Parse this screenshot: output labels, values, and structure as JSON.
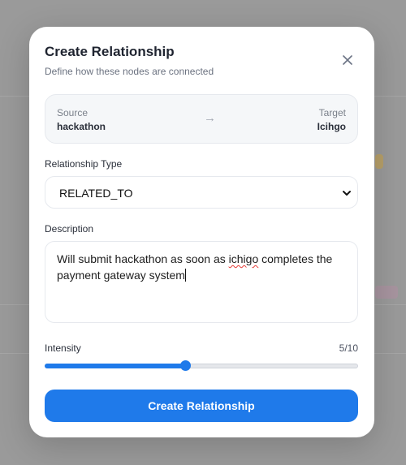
{
  "modal": {
    "title": "Create Relationship",
    "subtitle": "Define how these nodes are connected"
  },
  "connection": {
    "source_label": "Source",
    "source_value": "hackathon",
    "target_label": "Target",
    "target_value": "Icihgo",
    "arrow": "→"
  },
  "relationship_type": {
    "label": "Relationship Type",
    "selected": "RELATED_TO"
  },
  "description": {
    "label": "Description",
    "text_before": "Will submit hackathon as soon as ",
    "text_misspelled": "ichigo",
    "text_after": " completes the payment gateway system"
  },
  "intensity": {
    "label": "Intensity",
    "display": "5/10",
    "value": 5,
    "max": 10,
    "slider_fraction": 0.45
  },
  "submit": {
    "label": "Create Relationship"
  },
  "colors": {
    "accent": "#1f7aea",
    "spellcheck": "#e53935"
  },
  "icons": {
    "close": "close-icon",
    "chevron": "chevron-down-icon"
  }
}
